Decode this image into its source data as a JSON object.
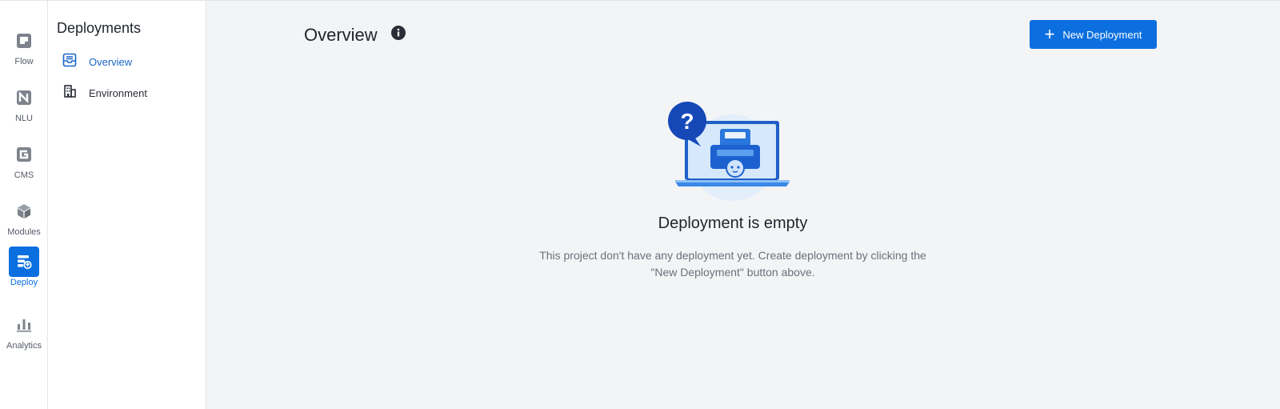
{
  "rail": {
    "items": [
      {
        "label": "Flow",
        "icon": "flow-icon",
        "active": false
      },
      {
        "label": "NLU",
        "icon": "nlu-icon",
        "active": false
      },
      {
        "label": "CMS",
        "icon": "cms-icon",
        "active": false
      },
      {
        "label": "Modules",
        "icon": "cube-icon",
        "active": false
      },
      {
        "label": "Deploy",
        "icon": "deploy-icon",
        "active": true
      },
      {
        "label": "Analytics",
        "icon": "bar-chart-icon",
        "active": false
      }
    ]
  },
  "subnav": {
    "title": "Deployments",
    "items": [
      {
        "label": "Overview",
        "icon": "inbox-icon",
        "active": true
      },
      {
        "label": "Environment",
        "icon": "building-icon",
        "active": false
      }
    ]
  },
  "main": {
    "title": "Overview",
    "info_icon": "info-icon",
    "new_button_label": "New Deployment",
    "empty": {
      "illustration": "empty-inbox-illustration",
      "question_mark": "?",
      "title": "Deployment is empty",
      "description": "This project don't have any deployment yet. Create deployment by clicking the \"New Deployment\" button above."
    }
  },
  "colors": {
    "accent": "#0b6fe0",
    "background": "#f3f4f6",
    "sidebar": "#ffffff"
  }
}
